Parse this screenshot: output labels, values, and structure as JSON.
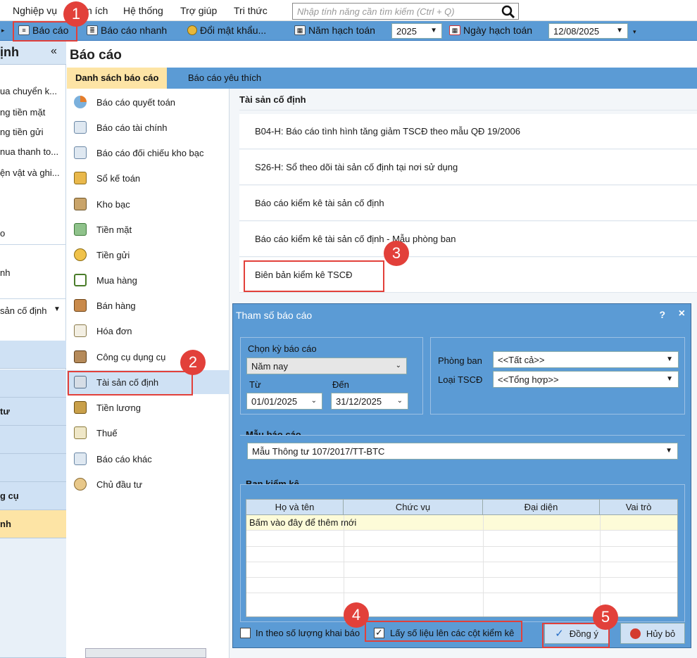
{
  "menubar": {
    "items": [
      "Nghiệp vụ",
      "n ích",
      "Hệ thống",
      "Trợ giúp",
      "Tri thức"
    ],
    "search_placeholder": "Nhập tính năng cần tìm kiếm (Ctrl + Q)"
  },
  "toolbar": {
    "bao_cao": "Báo cáo",
    "bao_cao_nhanh": "Báo cáo nhanh",
    "doi_mat_khau": "Đổi mật khẩu...",
    "nam_hach_toan_label": "Năm hạch toán",
    "nam_hach_toan_value": "2025",
    "ngay_hach_toan_label": "Ngày hạch toán",
    "ngay_hach_toan_value": "12/08/2025"
  },
  "left_panel": {
    "title": "ịnh",
    "collapse": "«",
    "items": [
      "ua chuyển k...",
      "ng tiền mặt",
      "ng tiền gửi",
      "nua thanh to...",
      "ện vật và ghi...",
      "o",
      "nh",
      "sản cố định"
    ],
    "buttons": [
      "",
      "",
      "tư",
      "",
      "",
      "g cụ",
      "nh",
      ""
    ]
  },
  "main": {
    "title": "Báo cáo",
    "tabs": [
      "Danh sách báo cáo",
      "Báo cáo yêu thích"
    ]
  },
  "report_list": [
    "Báo cáo quyết toán",
    "Báo cáo tài chính",
    "Báo cáo đối chiếu kho bạc",
    "Sổ kế toán",
    "Kho bạc",
    "Tiền mặt",
    "Tiền gửi",
    "Mua hàng",
    "Bán hàng",
    "Hóa đơn",
    "Công cụ dụng cụ",
    "Tài sản cố định",
    "Tiền lương",
    "Thuế",
    "Báo cáo khác",
    "Chủ đầu tư"
  ],
  "detail": {
    "heading": "Tài sản cố định",
    "rows": [
      "B04-H: Báo cáo tình hình tăng giảm TSCĐ theo mẫu QĐ 19/2006",
      "S26-H: Sổ theo dõi tài sản cố định tại nơi sử dụng",
      "Báo cáo kiểm kê tài sản cố định",
      "Báo cáo kiểm kê tài sản cố định - Mẫu phòng ban",
      "Biên bản kiểm kê TSCĐ"
    ]
  },
  "dialog": {
    "title": "Tham số báo cáo",
    "help": "?",
    "close": "×",
    "chon_ky_label": "Chọn kỳ báo cáo",
    "chon_ky_value": "Năm nay",
    "tu_label": "Từ",
    "tu_value": "01/01/2025",
    "den_label": "Đến",
    "den_value": "31/12/2025",
    "phong_ban_label": "Phòng ban",
    "phong_ban_value": "<<Tất cả>>",
    "loai_tscd_label": "Loại TSCĐ",
    "loai_tscd_value": "<<Tổng hợp>>",
    "mau_label": "Mẫu báo cáo",
    "mau_value": "Mẫu Thông tư 107/2017/TT-BTC",
    "ban_kiem_ke_label": "Ban kiểm kê",
    "columns": [
      "Họ và tên",
      "Chức vụ",
      "Đại diện",
      "Vai trò"
    ],
    "add_row": "Bấm vào đây để thêm mới",
    "in_theo_label": "In theo số lượng khai báo",
    "lay_so_lieu_label": "Lấy số liệu lên các cột kiểm kê",
    "dong_y": "Đồng ý",
    "huy_bo": "Hủy bỏ"
  },
  "badges": [
    "1",
    "2",
    "3",
    "4",
    "5"
  ],
  "colors": {
    "accent": "#5b9bd5",
    "highlight": "#e2403a",
    "tab_active": "#fde4a5",
    "selected_row": "#cfe1f4"
  }
}
